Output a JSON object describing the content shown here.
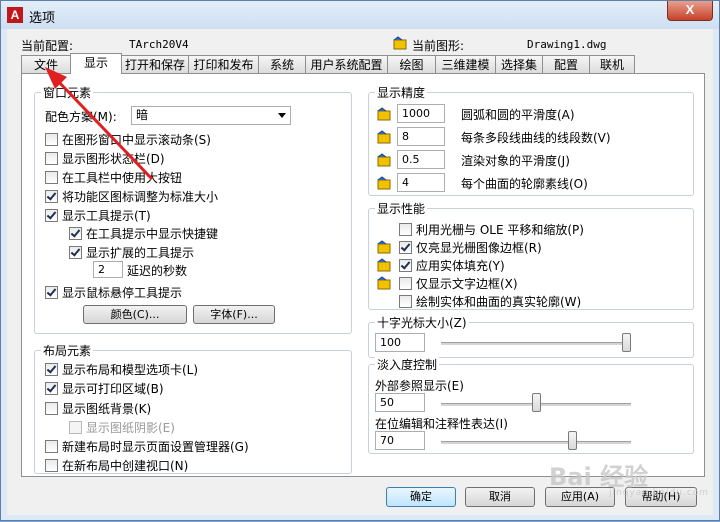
{
  "window": {
    "title": "选项",
    "close_glyph": "X",
    "app_icon_letter": "A"
  },
  "header": {
    "profile_label": "当前配置:",
    "profile_value": "TArch20V4",
    "drawing_label": "当前图形:",
    "drawing_value": "Drawing1.dwg"
  },
  "tabs": [
    "文件",
    "显示",
    "打开和保存",
    "打印和发布",
    "系统",
    "用户系统配置",
    "绘图",
    "三维建模",
    "选择集",
    "配置",
    "联机"
  ],
  "window_elements": {
    "title": "窗口元素",
    "color_scheme_label": "配色方案(M):",
    "color_scheme_value": "暗",
    "options": [
      {
        "label": "在图形窗口中显示滚动条(S)",
        "checked": false
      },
      {
        "label": "显示图形状态栏(D)",
        "checked": false
      },
      {
        "label": "在工具栏中使用大按钮",
        "checked": false
      },
      {
        "label": "将功能区图标调整为标准大小",
        "checked": true
      },
      {
        "label": "显示工具提示(T)",
        "checked": true
      }
    ],
    "sub_options": [
      {
        "label": "在工具提示中显示快捷键",
        "checked": true
      },
      {
        "label": "显示扩展的工具提示",
        "checked": true
      }
    ],
    "delay_value": "2",
    "delay_label": "延迟的秒数",
    "rollover_label": "显示鼠标悬停工具提示",
    "rollover_checked": true,
    "colors_button": "颜色(C)...",
    "fonts_button": "字体(F)..."
  },
  "layout_elements": {
    "title": "布局元素",
    "options": [
      {
        "label": "显示布局和模型选项卡(L)",
        "checked": true
      },
      {
        "label": "显示可打印区域(B)",
        "checked": true
      },
      {
        "label": "显示图纸背景(K)",
        "checked": false
      }
    ],
    "paper_shadow_label": "显示图纸阴影(E)",
    "more_options": [
      {
        "label": "新建布局时显示页面设置管理器(G)",
        "checked": false
      },
      {
        "label": "在新布局中创建视口(N)",
        "checked": false
      }
    ]
  },
  "display_resolution": {
    "title": "显示精度",
    "items": [
      {
        "value": "1000",
        "label": "圆弧和圆的平滑度(A)"
      },
      {
        "value": "8",
        "label": "每条多段线曲线的线段数(V)"
      },
      {
        "value": "0.5",
        "label": "渲染对象的平滑度(J)"
      },
      {
        "value": "4",
        "label": "每个曲面的轮廓素线(O)"
      }
    ]
  },
  "display_performance": {
    "title": "显示性能",
    "items": [
      {
        "label": "利用光栅与 OLE 平移和缩放(P)",
        "checked": false
      },
      {
        "label": "仅亮显光栅图像边框(R)",
        "checked": true
      },
      {
        "label": "应用实体填充(Y)",
        "checked": true
      },
      {
        "label": "仅显示文字边框(X)",
        "checked": false
      },
      {
        "label": "绘制实体和曲面的真实轮廓(W)",
        "checked": false
      }
    ]
  },
  "crosshair": {
    "title": "十字光标大小(Z)",
    "value": "100",
    "level_pct": 100
  },
  "fade_control": {
    "title": "淡入度控制",
    "xref_label": "外部参照显示(E)",
    "xref_value": "50",
    "xref_level_pct": 50,
    "inplace_label": "在位编辑和注释性表达(I)",
    "inplace_value": "70",
    "inplace_level_pct": 70
  },
  "footer": {
    "ok": "确定",
    "cancel": "取消",
    "apply": "应用(A)",
    "help": "帮助(H)"
  },
  "watermark": {
    "text": "Bai 经验",
    "sub": "jingyan.baidu.com"
  }
}
